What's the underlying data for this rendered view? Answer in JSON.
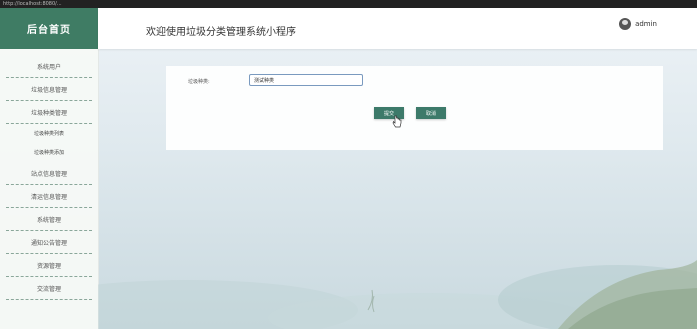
{
  "browser": {
    "tab_text": "http://localhost:8080/..."
  },
  "sidebar": {
    "brand": "后台首页",
    "items": [
      {
        "label": "系统用户",
        "sub": false
      },
      {
        "label": "垃圾信息管理",
        "sub": false
      },
      {
        "label": "垃圾种类管理",
        "sub": false
      },
      {
        "label": "垃圾种类列表",
        "sub": true
      },
      {
        "label": "垃圾种类添加",
        "sub": true
      },
      {
        "label": "站点信息管理",
        "sub": false
      },
      {
        "label": "清运信息管理",
        "sub": false
      },
      {
        "label": "系统管理",
        "sub": false
      },
      {
        "label": "通知公告管理",
        "sub": false
      },
      {
        "label": "资源管理",
        "sub": false
      },
      {
        "label": "交流管理",
        "sub": false
      }
    ]
  },
  "header": {
    "title": "欢迎使用垃圾分类管理系统小程序",
    "username": "admin"
  },
  "form": {
    "label": "垃圾种类:",
    "value": "测试种类",
    "submit_label": "提交",
    "cancel_label": "取消"
  },
  "colors": {
    "brand": "#3f7c64",
    "button": "#3d7a6a"
  }
}
